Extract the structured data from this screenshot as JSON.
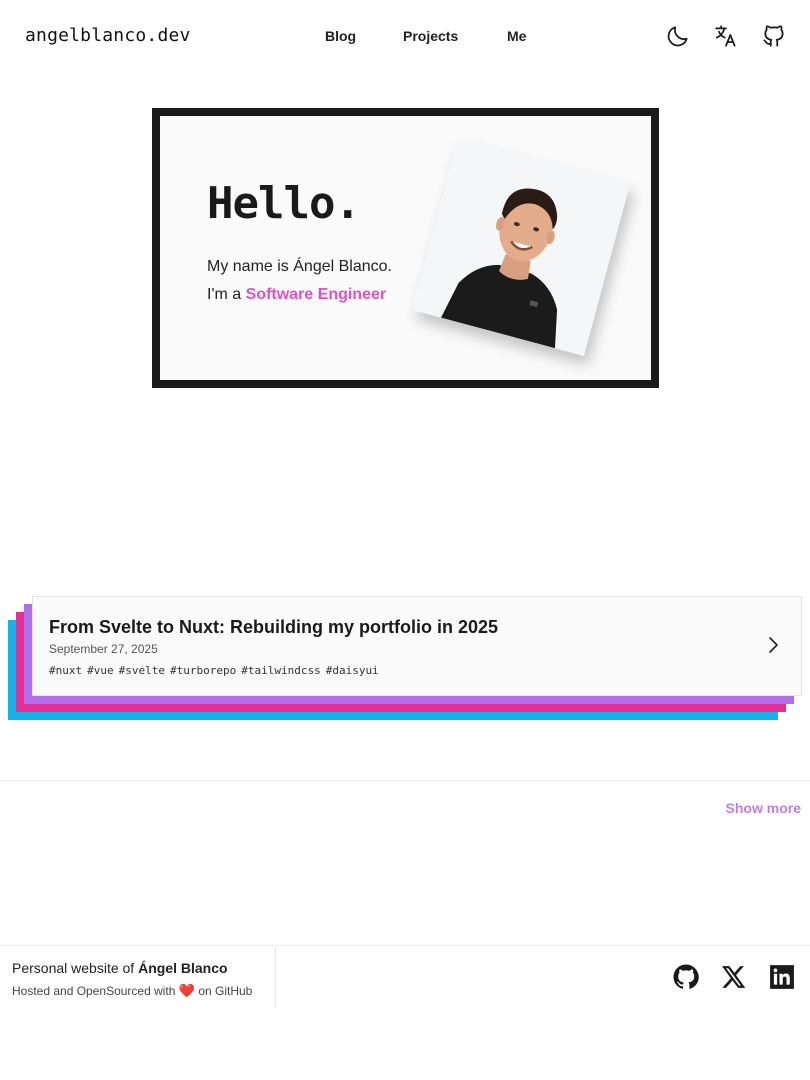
{
  "header": {
    "logo": "angelblanco.dev",
    "nav": [
      {
        "label": "Blog"
      },
      {
        "label": "Projects"
      },
      {
        "label": "Me"
      }
    ],
    "icons": [
      "moon-icon",
      "translate-icon",
      "github-icon"
    ]
  },
  "hero": {
    "greeting": "Hello.",
    "intro_line1": "My name is Ángel Blanco.",
    "intro_prefix": "I'm a",
    "role": "Software Engineer",
    "role_color": "#e052c2"
  },
  "posts": [
    {
      "title": "From Svelte to Nuxt: Rebuilding my portfolio in 2025",
      "date": "September 27, 2025",
      "tags": [
        "#nuxt",
        "#vue",
        "#svelte",
        "#turborepo",
        "#tailwindcss",
        "#daisyui"
      ],
      "layer_colors": [
        "#13b4ea",
        "#e52f95",
        "#b26ee8"
      ]
    }
  ],
  "show_more": "Show more",
  "footer": {
    "line1_prefix": "Personal website of",
    "name": "Ángel Blanco",
    "line2_prefix": "Hosted and OpenSourced with",
    "heart": "❤️",
    "line2_suffix": "on GitHub",
    "social_icons": [
      "github-icon",
      "x-icon",
      "linkedin-icon"
    ]
  },
  "colors": {
    "accent": "#c07ee2",
    "text": "#1a1a1a"
  }
}
